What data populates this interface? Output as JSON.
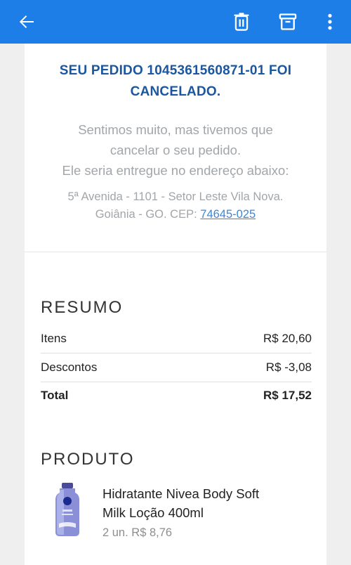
{
  "appbar": {
    "back_icon": "arrow-left-icon",
    "delete_icon": "trash-icon",
    "archive_icon": "archive-icon",
    "more_icon": "more-vertical-icon",
    "color": "#1c7ee6"
  },
  "email": {
    "headline_line1": "SEU PEDIDO 1045361560871-01 FOI",
    "headline_line2": "CANCELADO.",
    "message_line1": "Sentimos muito, mas tivemos que",
    "message_line2": "cancelar o seu pedido.",
    "message_line3": "Ele seria entregue no endereço abaixo:",
    "address_line1": "5ª Avenida - 1101 - Setor Leste Vila Nova.",
    "address_line2_prefix": "Goiânia - GO. CEP:",
    "cep": "74645-025"
  },
  "summary": {
    "title": "RESUMO",
    "rows": [
      {
        "label": "Itens",
        "value": "R$ 20,60"
      },
      {
        "label": "Descontos",
        "value": "R$ -3,08"
      },
      {
        "label": "Total",
        "value": "R$ 17,52"
      }
    ]
  },
  "product": {
    "title": "PRODUTO",
    "name_line1": "Hidratante Nivea Body Soft",
    "name_line2": "Milk Loção 400ml",
    "quantity": "2 un.",
    "price": "R$ 8,76"
  }
}
